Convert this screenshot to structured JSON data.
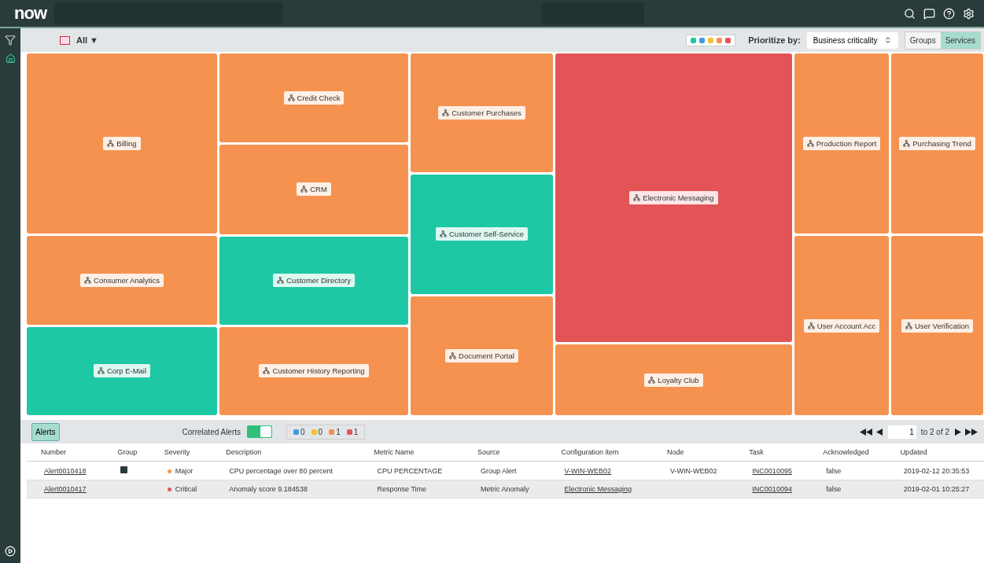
{
  "header": {
    "logo": "now"
  },
  "toolbar": {
    "filter_label": "All ▼",
    "legend": [
      {
        "color": "#1fc8a4"
      },
      {
        "color": "#3d9de0"
      },
      {
        "color": "#f5c231"
      },
      {
        "color": "#f5924f"
      },
      {
        "color": "#e35457"
      }
    ],
    "prioritize_label": "Prioritize by:",
    "prioritize_value": "Business criticality",
    "view_toggle": [
      {
        "label": "Groups",
        "selected": false
      },
      {
        "label": "Services",
        "selected": true
      }
    ]
  },
  "treemap": [
    {
      "tiles": [
        {
          "label": "Billing",
          "color": "#f5924f"
        },
        {
          "label": "Consumer Analytics",
          "color": "#f5924f"
        },
        {
          "label": "Corp E-Mail",
          "color": "#1fc8a4"
        }
      ]
    },
    {
      "tiles": [
        {
          "label": "Credit Check",
          "color": "#f5924f"
        },
        {
          "label": "CRM",
          "color": "#f5924f"
        },
        {
          "label": "Customer Directory",
          "color": "#1fc8a4"
        },
        {
          "label": "Customer History Reporting",
          "color": "#f5924f"
        }
      ]
    },
    {
      "tiles": [
        {
          "label": "Customer Purchases",
          "color": "#f5924f"
        },
        {
          "label": "Customer Self-Service",
          "color": "#1fc8a4"
        },
        {
          "label": "Document Portal",
          "color": "#f5924f"
        }
      ]
    },
    {
      "tiles": [
        {
          "label": "Electronic Messaging",
          "color": "#e35457"
        },
        {
          "label": "Loyalty Club",
          "color": "#f5924f"
        }
      ]
    },
    {
      "tiles": [
        {
          "label": "Production Report",
          "color": "#f5924f"
        },
        {
          "label": "User Account Acc",
          "color": "#f5924f"
        }
      ]
    },
    {
      "tiles": [
        {
          "label": "Purchasing Trend",
          "color": "#f5924f"
        },
        {
          "label": "User Verification",
          "color": "#f5924f"
        }
      ]
    }
  ],
  "alerts": {
    "tab": "Alerts",
    "correlated_label": "Correlated Alerts",
    "correlated_on": true,
    "counts": [
      {
        "color": "#3d9de0",
        "count": "0"
      },
      {
        "color": "#f5c231",
        "count": "0"
      },
      {
        "color": "#f5924f",
        "count": "1"
      },
      {
        "color": "#e35457",
        "count": "1"
      }
    ],
    "page_input": "1",
    "page_text": "to 2 of 2",
    "columns": [
      "Number",
      "Group",
      "Severity",
      "Description",
      "Metric Name",
      "Source",
      "Configuration item",
      "Node",
      "Task",
      "Acknowledged",
      "Updated"
    ],
    "rows": [
      {
        "number": "Alert0010418",
        "has_group": true,
        "severity": "Major",
        "color": "#f5924f",
        "description": "CPU percentage over 80 percent",
        "metric": "CPU PERCENTAGE",
        "source": "Group Alert",
        "ci": "V-WIN-WEB02",
        "node": "V-WIN-WEB02",
        "task": "INC0010095",
        "acknowledged": "false",
        "updated": "2019-02-12 20:35:53"
      },
      {
        "number": "Alert0010417",
        "has_group": false,
        "severity": "Critical",
        "color": "#e35457",
        "description": "Anomaly score 9.184538",
        "metric": "Response Time",
        "source": "Metric Anomaly",
        "ci": "Electronic Messaging",
        "node": "",
        "task": "INC0010094",
        "acknowledged": "false",
        "updated": "2019-02-01 10:25:27"
      }
    ]
  }
}
